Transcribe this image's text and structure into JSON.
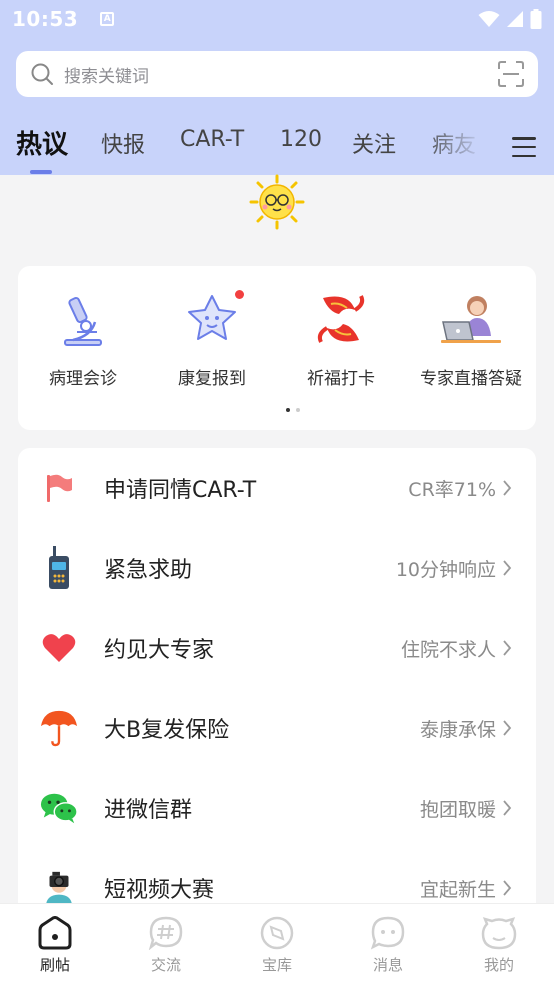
{
  "status": {
    "time": "10:53",
    "notification_glyph": "A"
  },
  "search": {
    "placeholder": "搜索关键词",
    "icon": "search-icon",
    "scan_icon": "scan-icon"
  },
  "tabs": [
    {
      "label": "热议",
      "active": true
    },
    {
      "label": "快报"
    },
    {
      "label": "CAR-T"
    },
    {
      "label": "120"
    },
    {
      "label": "关注"
    },
    {
      "label": "病友"
    }
  ],
  "quick_actions": [
    {
      "label": "病理会诊",
      "icon": "microscope-icon"
    },
    {
      "label": "康复报到",
      "icon": "star-face-icon",
      "has_dot": true
    },
    {
      "label": "祈福打卡",
      "icon": "koi-fish-icon"
    },
    {
      "label": "专家直播答疑",
      "icon": "doctor-laptop-icon"
    }
  ],
  "pager": {
    "current": 1,
    "total": 2
  },
  "list": [
    {
      "title": "申请同情CAR-T",
      "sub": "CR率71%",
      "icon": "flag-icon"
    },
    {
      "title": "紧急求助",
      "sub": "10分钟响应",
      "icon": "walkie-talkie-icon"
    },
    {
      "title": "约见大专家",
      "sub": "住院不求人",
      "icon": "heart-icon"
    },
    {
      "title": "大B复发保险",
      "sub": "泰康承保",
      "icon": "umbrella-icon"
    },
    {
      "title": "进微信群",
      "sub": "抱团取暖",
      "icon": "wechat-icon"
    },
    {
      "title": "短视频大赛",
      "sub": "宜起新生",
      "icon": "cameraman-icon"
    }
  ],
  "nav": [
    {
      "label": "刷帖",
      "icon": "home-icon",
      "active": true
    },
    {
      "label": "交流",
      "icon": "hash-bubble-icon"
    },
    {
      "label": "宝库",
      "icon": "compass-icon"
    },
    {
      "label": "消息",
      "icon": "chat-bubble-icon"
    },
    {
      "label": "我的",
      "icon": "profile-icon"
    }
  ],
  "colors": {
    "header_bg": "#c8d3fa",
    "accent": "#6b7ee8",
    "badge_red": "#f24040"
  }
}
